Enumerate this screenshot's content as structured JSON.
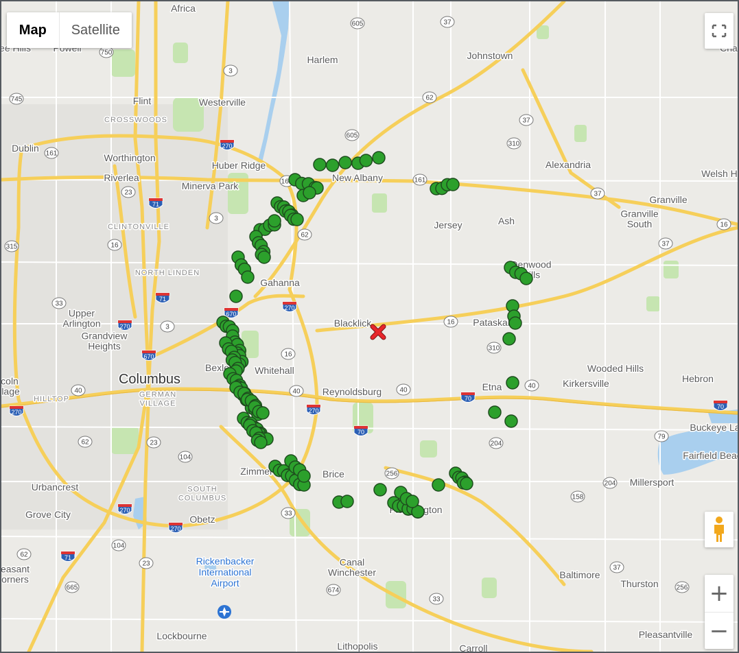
{
  "map_type": {
    "map_label": "Map",
    "satellite_label": "Satellite",
    "selected": "Map"
  },
  "controls": {
    "zoom_in": "+",
    "zoom_out": "−"
  },
  "colors": {
    "marker_fill": "#2ca02c",
    "marker_stroke": "#1e4d1e",
    "target_marker": "#e8262b",
    "highway": "#fbd45b",
    "water": "#a9cfee",
    "park": "#c6e5b1"
  },
  "labels": [
    {
      "t": "Africa"
    },
    {
      "t": "Harlem"
    },
    {
      "t": "Johnstown"
    },
    {
      "t": "Flint"
    },
    {
      "t": "Westerville"
    },
    {
      "t": "CROSSWOODS"
    },
    {
      "t": "Dublin"
    },
    {
      "t": "Worthington"
    },
    {
      "t": "Huber Ridge"
    },
    {
      "t": "Riverlea"
    },
    {
      "t": "Minerva Park"
    },
    {
      "t": "New Albany"
    },
    {
      "t": "Alexandria"
    },
    {
      "t": "Welsh Hi"
    },
    {
      "t": "Granville"
    },
    {
      "t": "Jersey"
    },
    {
      "t": "Ash"
    },
    {
      "t": "Granville South"
    },
    {
      "t": "CLINTONVILLE"
    },
    {
      "t": "NORTH LINDEN"
    },
    {
      "t": "Gahanna"
    },
    {
      "t": "Denwood Hills"
    },
    {
      "t": "Blacklick"
    },
    {
      "t": "Pataskala"
    },
    {
      "t": "Upper Arlington"
    },
    {
      "t": "Grandview Heights"
    },
    {
      "t": "Bexley"
    },
    {
      "t": "Whitehall"
    },
    {
      "t": "Wooded Hills"
    },
    {
      "t": "Columbus"
    },
    {
      "t": "Reynoldsburg"
    },
    {
      "t": "Etna"
    },
    {
      "t": "Kirkersville"
    },
    {
      "t": "Hebron"
    },
    {
      "t": "HILLTOP"
    },
    {
      "t": "GERMAN VILLAGE"
    },
    {
      "t": "Buckeye La"
    },
    {
      "t": "Fairfield Beac"
    },
    {
      "t": "Zimmer"
    },
    {
      "t": "Brice"
    },
    {
      "t": "Urbancrest"
    },
    {
      "t": "SOUTH COLUMBUS"
    },
    {
      "t": "Millersport"
    },
    {
      "t": "Grove City"
    },
    {
      "t": "Obetz"
    },
    {
      "t": "Pickerington"
    },
    {
      "t": "Canal Winchester"
    },
    {
      "t": "Baltimore"
    },
    {
      "t": "Thurston"
    },
    {
      "t": "Rickenbacker International Airport"
    },
    {
      "t": "Lockbourne"
    },
    {
      "t": "Lithopolis"
    },
    {
      "t": "Pleasantville"
    },
    {
      "t": "Carroll"
    },
    {
      "t": "Powell"
    },
    {
      "t": "ee Hills"
    },
    {
      "t": "easant orners"
    },
    {
      "t": "Cha"
    },
    {
      "t": "colnllage"
    }
  ],
  "shields": [
    "605",
    "37",
    "750",
    "745",
    "3",
    "62",
    "37",
    "605",
    "310",
    "270",
    "161",
    "23",
    "161",
    "161",
    "37",
    "16",
    "71",
    "3",
    "62",
    "37",
    "16",
    "315",
    "270",
    "270",
    "33",
    "71",
    "3",
    "670",
    "16",
    "310",
    "670",
    "16",
    "40",
    "40",
    "40",
    "70",
    "270",
    "40",
    "70",
    "70",
    "270",
    "62",
    "23",
    "104",
    "256",
    "204",
    "79",
    "204",
    "33",
    "158",
    "270",
    "270",
    "62",
    "104",
    "71",
    "23",
    "665",
    "674",
    "33",
    "37",
    "256"
  ],
  "markers": {
    "count": 152
  },
  "target": {
    "name": "Blacklick"
  }
}
